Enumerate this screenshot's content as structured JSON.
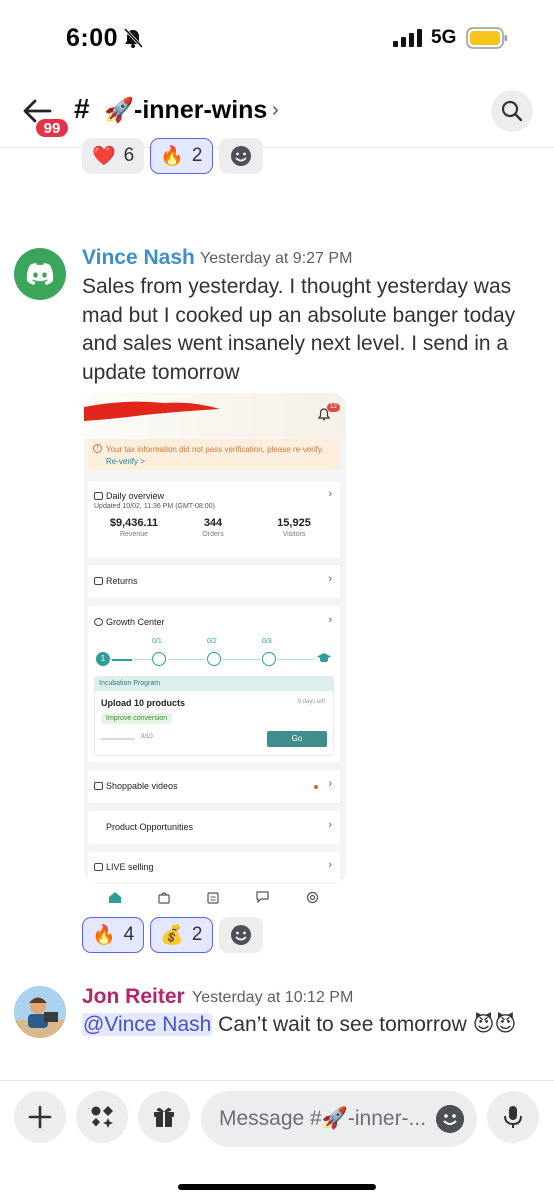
{
  "status_bar": {
    "time": "6:00",
    "network": "5G"
  },
  "header": {
    "back_badge": "99",
    "hash": "#",
    "channel_emoji": "🚀",
    "channel_name": "-inner-wins",
    "chevron": "›"
  },
  "prev_reactions": [
    {
      "emoji": "❤️",
      "count": "6"
    },
    {
      "emoji": "🔥",
      "count": "2"
    }
  ],
  "messages": [
    {
      "author": "Vince Nash",
      "author_color": "#3d8fc9",
      "timestamp": "Yesterday at 9:27 PM",
      "text": "Sales from yesterday.  I thought yesterday was mad but I cooked up an absolute banger today and sales went insanely next level.  I send in a update tomorrow",
      "reactions": [
        {
          "emoji": "🔥",
          "count": "4"
        },
        {
          "emoji": "💰",
          "count": "2"
        }
      ]
    },
    {
      "author": "Jon Reiter",
      "author_color": "#b0256b",
      "timestamp": "Yesterday at 10:12 PM",
      "mention": "@Vince Nash",
      "text": " Can’t wait to see tomorrow 😈😈"
    }
  ],
  "attachment": {
    "bell_badge": "12",
    "tax_notice": "Your tax information did not pass verification, please re-verify.",
    "reverify_link": "Re-verify >",
    "daily_overview": {
      "title": "Daily overview",
      "updated": "Updated 10/02, 11:36 PM (GMT-08:00)",
      "metrics": [
        {
          "value": "$9,436.11",
          "label": "Revenue"
        },
        {
          "value": "344",
          "label": "Orders"
        },
        {
          "value": "15,925",
          "label": "Visitors"
        }
      ]
    },
    "returns": "Returns",
    "growth_center": {
      "title": "Growth Center",
      "step_current": "1",
      "step_labels": [
        "0/1",
        "0/2",
        "0/3"
      ],
      "program": "Incubation Program",
      "task": "Upload 10 products",
      "days_left": "9 days left",
      "tag": "Improve conversion",
      "progress": "0/10",
      "go": "Go"
    },
    "shoppable_videos": "Shoppable videos",
    "product_opportunities": "Product Opportunities",
    "live_selling": "LIVE selling"
  },
  "input": {
    "placeholder": "Message #🚀-inner-..."
  }
}
